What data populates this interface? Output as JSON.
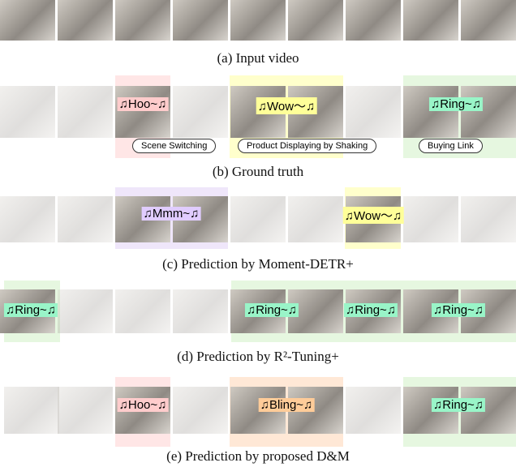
{
  "captions": {
    "a": "(a) Input video",
    "b": "(b) Ground truth",
    "c": "(c) Prediction by Moment-DETR+",
    "d": "(d) Prediction by R²-Tuning+",
    "e": "(e) Prediction by proposed D&M"
  },
  "labels": {
    "hoo": "♫Hoo~♫",
    "wow": "♫Wow～♫",
    "ring": "♫Ring~♫",
    "mmm": "♫Mmm~♫",
    "bling": "♫Bling~♫"
  },
  "callouts": [
    "Scene Switching",
    "Product Displaying by Shaking",
    "Buying Link"
  ],
  "colors": {
    "pink": "#ffe6e6",
    "yellow": "#ffffcc",
    "green": "#e6f7e0",
    "purple": "#efe6fa",
    "orange": "#ffe8d6",
    "label_pink": "#ffcccc",
    "label_yellow": "#ffff99",
    "label_green": "#99f5c8",
    "label_purple": "#e0ccff",
    "label_orange": "#ffcc99"
  }
}
